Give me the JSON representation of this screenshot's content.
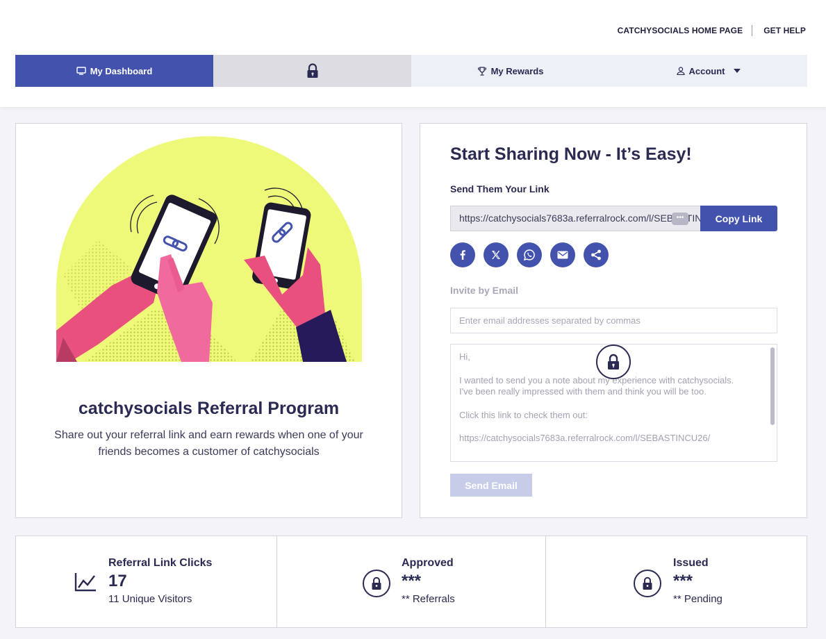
{
  "header": {
    "links": [
      {
        "label": "CATCHYSOCIALS HOME PAGE"
      },
      {
        "label": "GET HELP"
      }
    ]
  },
  "nav": {
    "tabs": [
      {
        "label": "My Dashboard",
        "icon": "monitor-icon",
        "active": true
      },
      {
        "label": "",
        "icon": "lock-icon",
        "locked": true
      },
      {
        "label": "My Rewards",
        "icon": "trophy-icon"
      },
      {
        "label": "Account",
        "icon": "user-icon"
      }
    ]
  },
  "program": {
    "title": "catchysocials Referral Program",
    "description": "Share out your referral link and earn rewards when one of your friends becomes a customer of catchysocials"
  },
  "share": {
    "title": "Start Sharing Now - It’s Easy!",
    "send_link_label": "Send Them Your Link",
    "link_value": "https://catchysocials7683a.referralrock.com/l/SEBASTINCU26/",
    "copy_label": "Copy Link",
    "social_icons": [
      "facebook-icon",
      "x-icon",
      "whatsapp-icon",
      "email-icon",
      "share-icon"
    ],
    "invite_label": "Invite by Email",
    "email_placeholder": "Enter email addresses separated by commas",
    "message": {
      "greeting": "Hi,",
      "body": "I wanted to send you a note about my experience with catchysocials. I've been really impressed with them and think you will be too.",
      "cta": "Click this link to check them out:",
      "link": "https://catchysocials7683a.referralrock.com/l/SEBASTINCU26/"
    },
    "send_label": "Send Email"
  },
  "stats": [
    {
      "title": "Referral Link Clicks",
      "value": "17",
      "sub": "11 Unique Visitors",
      "icon": "line-chart-icon"
    },
    {
      "title": "Approved",
      "value": "***",
      "sub": "** Referrals",
      "icon": "lock-icon"
    },
    {
      "title": "Issued",
      "value": "***",
      "sub": "** Pending",
      "icon": "lock-icon"
    }
  ],
  "colors": {
    "primary": "#4353ad",
    "text": "#2a2a52",
    "illustration_circle": "#eef97a",
    "hand_pink": "#e8507e"
  }
}
